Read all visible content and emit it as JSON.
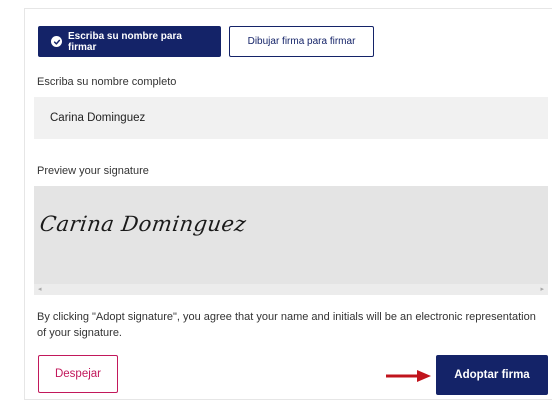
{
  "tabs": {
    "type_name": "Escriba su nombre para firmar",
    "draw": "Dibujar firma para firmar"
  },
  "name_section": {
    "label": "Escriba su nombre completo",
    "value": "Carina Dominguez"
  },
  "preview": {
    "label": "Preview your signature",
    "signature": "Carina Dominguez",
    "scroll_left_glyph": "◂",
    "scroll_right_glyph": "▸"
  },
  "consent_text": "By clicking \"Adopt signature\", you agree that your name and initials will be an electronic representation of your signature.",
  "actions": {
    "clear_label": "Despejar",
    "adopt_label": "Adoptar firma"
  },
  "colors": {
    "primary": "#142368",
    "danger": "#c2185b",
    "arrow": "#c0141c"
  },
  "icons": {
    "active_tab": "check-circle-icon",
    "pointer": "arrow-right-icon"
  }
}
